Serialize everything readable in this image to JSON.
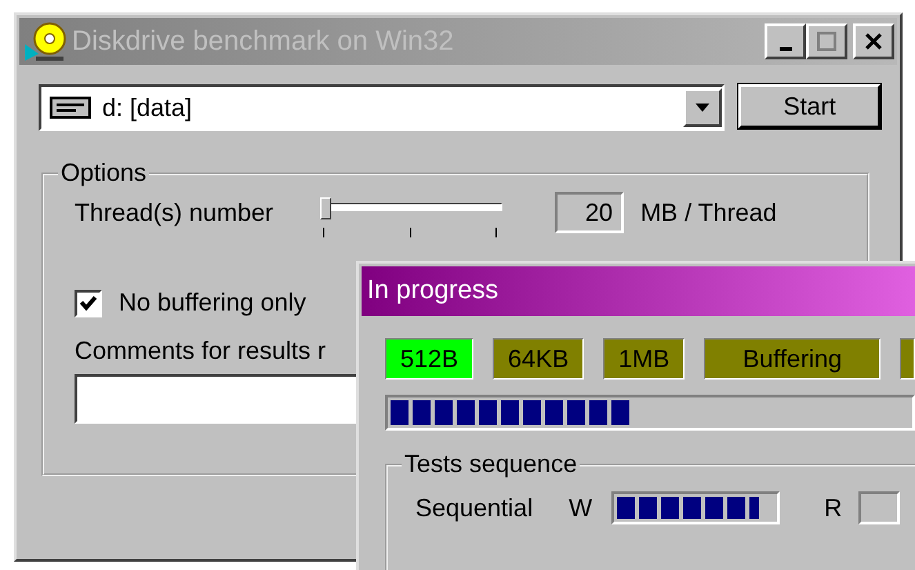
{
  "window": {
    "title": "Diskdrive benchmark on Win32"
  },
  "drive_select": {
    "value": "d: [data]"
  },
  "start_button": "Start",
  "options": {
    "title": "Options",
    "thread_label": "Thread(s) number",
    "thread_slider": {
      "level": 0
    },
    "size_value": "20",
    "size_unit": "MB / Thread",
    "no_buffering": {
      "label": "No buffering only",
      "checked": true
    },
    "comments_label": "Comments for results r"
  },
  "progress_dialog": {
    "title": "In progress",
    "indicators": [
      {
        "label": "512B",
        "active": true
      },
      {
        "label": "64KB",
        "active": false
      },
      {
        "label": "1MB",
        "active": false
      },
      {
        "label": "Buffering",
        "active": false
      }
    ],
    "progress": {
      "level": 0.46
    },
    "tests": {
      "title": "Tests sequence",
      "rows": [
        {
          "label": "Sequential",
          "write": {
            "label": "W",
            "level": 0.9
          },
          "read": {
            "label": "R"
          }
        }
      ]
    }
  }
}
